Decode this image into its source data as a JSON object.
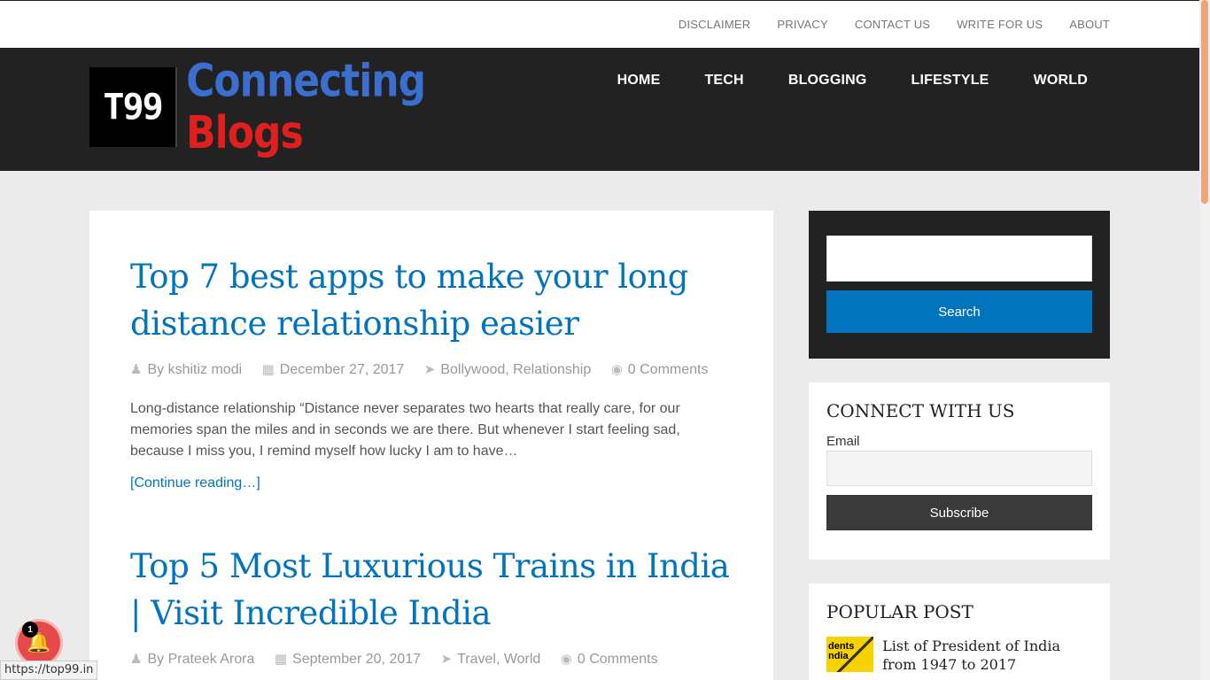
{
  "topbar": {
    "links": [
      "DISCLAIMER",
      "PRIVACY",
      "CONTACT US",
      "WRITE FOR US",
      "ABOUT"
    ]
  },
  "header": {
    "logo_mark": "T99",
    "logo_text_blue": "Connecting",
    "logo_text_red": "Blogs",
    "nav": [
      "HOME",
      "TECH",
      "BLOGGING",
      "LIFESTYLE",
      "WORLD"
    ]
  },
  "posts": [
    {
      "title": "Top 7 best apps to make your long distance relationship easier",
      "author": "By kshitiz modi",
      "date": "December 27, 2017",
      "categories": "Bollywood, Relationship",
      "comments": "0 Comments",
      "excerpt": "Long-distance relationship “Distance never separates two hearts that really care, for our memories span the miles and in seconds we are there. But whenever I start feeling sad, because I miss you, I remind myself how lucky I am to have…",
      "more": "[Continue reading…]"
    },
    {
      "title": "Top 5 Most Luxurious Trains in India | Visit Incredible India",
      "author": "By Prateek Arora",
      "date": "September 20, 2017",
      "categories": "Travel, World",
      "comments": "0 Comments"
    }
  ],
  "sidebar": {
    "search_button": "Search",
    "connect": {
      "title": "CONNECT WITH US",
      "email_label": "Email",
      "subscribe": "Subscribe"
    },
    "popular": {
      "title": "POPULAR POST",
      "items": [
        {
          "title": "List of President of India from 1947 to 2017",
          "thumb_text": "dents\nndia"
        }
      ]
    }
  },
  "notification": {
    "count": "1"
  },
  "status_url": "https://top99.in"
}
